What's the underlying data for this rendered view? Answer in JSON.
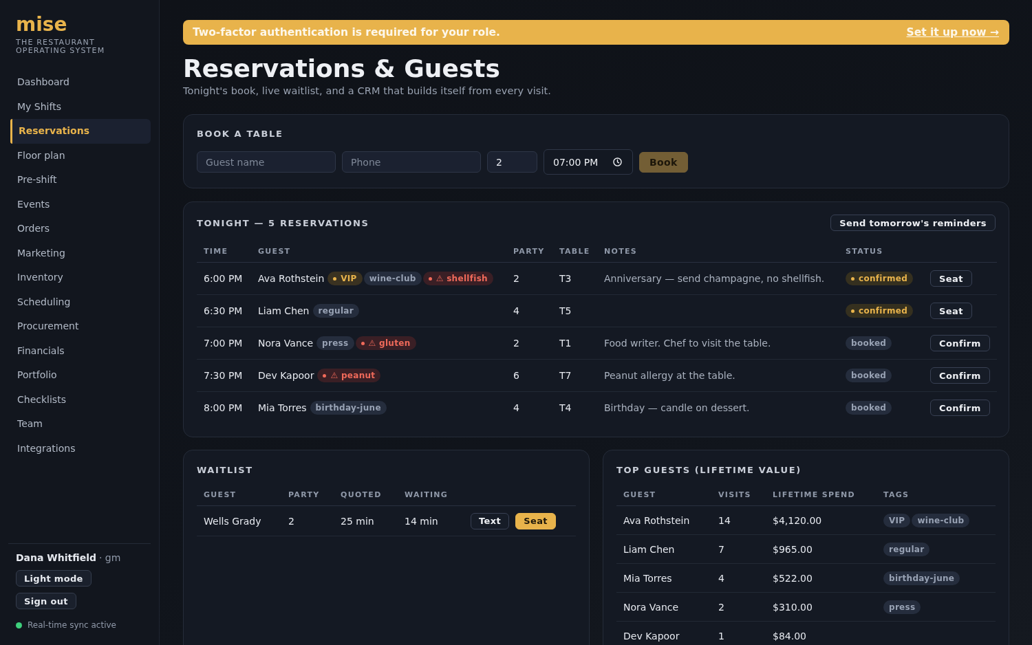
{
  "sidebar": {
    "logo": "mise",
    "tagline": "THE RESTAURANT OPERATING SYSTEM",
    "items": [
      {
        "label": "Dashboard",
        "selected": false
      },
      {
        "label": "My Shifts",
        "selected": false
      },
      {
        "label": "Reservations",
        "selected": true
      },
      {
        "label": "Floor plan",
        "selected": false
      },
      {
        "label": "Pre-shift",
        "selected": false
      },
      {
        "label": "Events",
        "selected": false
      },
      {
        "label": "Orders",
        "selected": false
      },
      {
        "label": "Marketing",
        "selected": false
      },
      {
        "label": "Inventory",
        "selected": false
      },
      {
        "label": "Scheduling",
        "selected": false
      },
      {
        "label": "Procurement",
        "selected": false
      },
      {
        "label": "Financials",
        "selected": false
      },
      {
        "label": "Portfolio",
        "selected": false
      },
      {
        "label": "Checklists",
        "selected": false
      },
      {
        "label": "Team",
        "selected": false
      },
      {
        "label": "Integrations",
        "selected": false
      }
    ],
    "user": {
      "name": "Dana Whitfield",
      "role": "· gm"
    },
    "buttons": [
      "Light mode",
      "Sign out"
    ],
    "sync_status": "Real-time sync active"
  },
  "banner": {
    "message": "Two-factor authentication is required for your role.",
    "link": "Set it up now →"
  },
  "page": {
    "title": "Reservations & Guests",
    "subtitle": "Tonight's book, live waitlist, and a CRM that builds itself from every visit."
  },
  "book_table": {
    "title": "BOOK A TABLE",
    "fields": [
      {
        "kind": "text",
        "placeholder": "Guest name"
      },
      {
        "kind": "text",
        "placeholder": "Phone"
      },
      {
        "kind": "number",
        "value": "2"
      },
      {
        "kind": "time",
        "value": "07:00 PM"
      }
    ],
    "button": {
      "label": "Book",
      "disabled": true
    }
  },
  "reservations": {
    "title": "TONIGHT — 5 RESERVATIONS",
    "button": "Send tomorrow's reminders",
    "columns": [
      "TIME",
      "GUEST",
      "PARTY",
      "TABLE",
      "NOTES",
      "STATUS"
    ],
    "rows": [
      {
        "time": "6:00 PM",
        "guest": "Ava Rothstein",
        "tags": [
          {
            "label": "VIP",
            "kind": "vip"
          },
          {
            "label": "wine-club",
            "kind": "tag"
          },
          {
            "label": "⚠ shellfish",
            "kind": "allergy"
          }
        ],
        "party": "2",
        "table": "T3",
        "notes": "Anniversary — send champagne, no shellfish.",
        "status": {
          "label": "confirmed",
          "kind": "confirmed"
        },
        "action": "Seat"
      },
      {
        "time": "6:30 PM",
        "guest": "Liam Chen",
        "tags": [
          {
            "label": "regular",
            "kind": "tag"
          }
        ],
        "party": "4",
        "table": "T5",
        "status": {
          "label": "confirmed",
          "kind": "confirmed"
        },
        "action": "Seat"
      },
      {
        "time": "7:00 PM",
        "guest": "Nora Vance",
        "tags": [
          {
            "label": "press",
            "kind": "tag"
          },
          {
            "label": "⚠ gluten",
            "kind": "allergy"
          }
        ],
        "party": "2",
        "table": "T1",
        "notes": "Food writer. Chef to visit the table.",
        "status": {
          "label": "booked",
          "kind": "booked"
        },
        "action": "Confirm"
      },
      {
        "time": "7:30 PM",
        "guest": "Dev Kapoor",
        "tags": [
          {
            "label": "⚠ peanut",
            "kind": "allergy"
          }
        ],
        "party": "6",
        "table": "T7",
        "notes": "Peanut allergy at the table.",
        "status": {
          "label": "booked",
          "kind": "booked"
        },
        "action": "Confirm"
      },
      {
        "time": "8:00 PM",
        "guest": "Mia Torres",
        "tags": [
          {
            "label": "birthday-june",
            "kind": "tag"
          }
        ],
        "party": "4",
        "table": "T4",
        "notes": "Birthday — candle on dessert.",
        "status": {
          "label": "booked",
          "kind": "booked"
        },
        "action": "Confirm"
      }
    ]
  },
  "waitlist": {
    "title": "WAITLIST",
    "columns": [
      "GUEST",
      "PARTY",
      "QUOTED",
      "WAITING"
    ],
    "rows": [
      {
        "guest": "Wells Grady",
        "party": "2",
        "quoted": "25 min",
        "waiting": "14 min",
        "actions": [
          {
            "label": "Text",
            "kind": "secondary"
          },
          {
            "label": "Seat",
            "kind": "primary"
          }
        ]
      }
    ]
  },
  "top_guests": {
    "title": "TOP GUESTS (LIFETIME VALUE)",
    "columns": [
      "GUEST",
      "VISITS",
      "LIFETIME SPEND",
      "TAGS"
    ],
    "rows": [
      {
        "guest": "Ava Rothstein",
        "visits": "14",
        "spend": "$4,120.00",
        "tags": [
          "VIP",
          "wine-club"
        ]
      },
      {
        "guest": "Liam Chen",
        "visits": "7",
        "spend": "$965.00",
        "tags": [
          "regular"
        ]
      },
      {
        "guest": "Mia Torres",
        "visits": "4",
        "spend": "$522.00",
        "tags": [
          "birthday-june"
        ]
      },
      {
        "guest": "Nora Vance",
        "visits": "2",
        "spend": "$310.00",
        "tags": [
          "press"
        ]
      },
      {
        "guest": "Dev Kapoor",
        "visits": "1",
        "spend": "$84.00"
      }
    ]
  }
}
